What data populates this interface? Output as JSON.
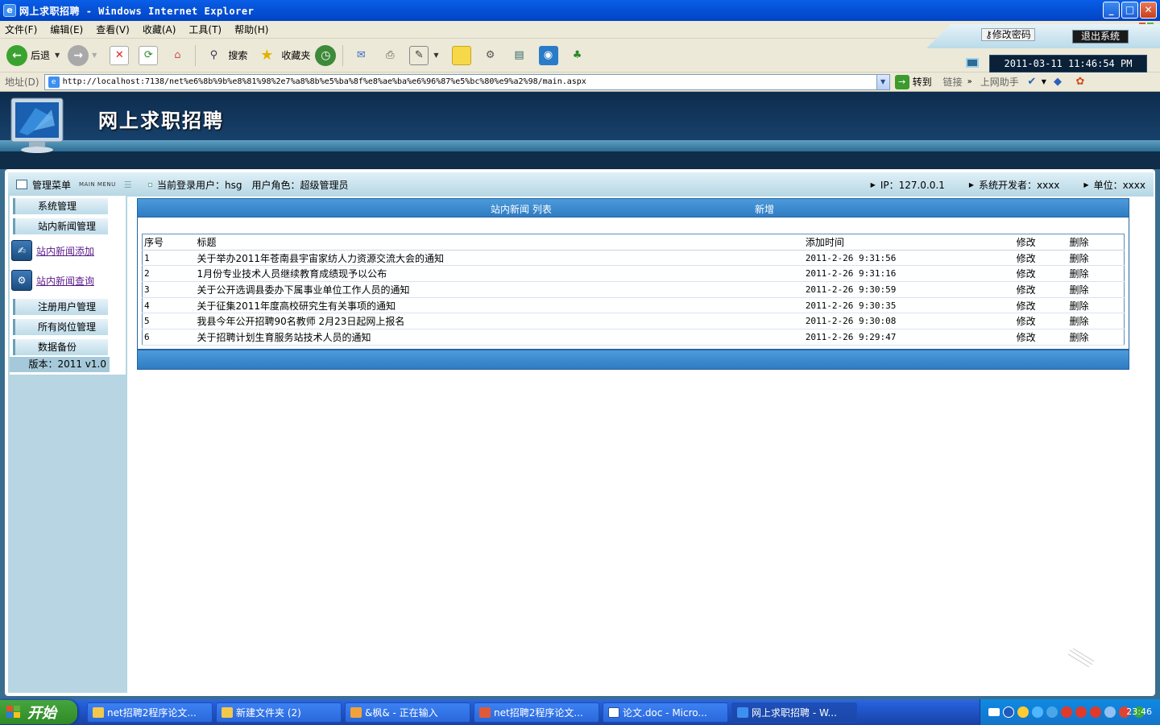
{
  "window": {
    "title": "网上求职招聘 - Windows Internet Explorer",
    "controls": [
      "_",
      "□",
      "✕"
    ]
  },
  "menubar": [
    "文件(F)",
    "编辑(E)",
    "查看(V)",
    "收藏(A)",
    "工具(T)",
    "帮助(H)"
  ],
  "toolbar": {
    "back": "后退",
    "search": "搜索",
    "favorites": "收藏夹"
  },
  "address": {
    "label": "地址(D)",
    "url": "http://localhost:7138/net%e6%8b%9b%e8%81%98%2e7%a8%8b%e5%ba%8f%e8%ae%ba%e6%96%87%e5%bc%80%e9%a2%98/main.aspx",
    "go": "转到",
    "links": "链接",
    "helper": "上网助手"
  },
  "app": {
    "title": "网上求职招聘",
    "change_password": "修改密码",
    "logout": "退出系统",
    "datetime": "2011-03-11 11:46:54 PM"
  },
  "menu": {
    "title": "管理菜单",
    "subtitle": "MAIN MENU",
    "items": [
      "系统管理",
      "站内新闻管理"
    ],
    "links": [
      "站内新闻添加",
      "站内新闻查询"
    ],
    "items2": [
      "注册用户管理",
      "所有岗位管理",
      "数据备份"
    ],
    "version": "版本：2011 v1.0"
  },
  "info": {
    "user": "当前登录用户：hsg",
    "role": "用户角色：超级管理员",
    "ip": "IP：127.0.0.1",
    "developer": "系统开发者：xxxx",
    "unit": "单位：xxxx"
  },
  "content": {
    "title": "站内新闻 列表",
    "add": "新增",
    "headers": [
      "序号",
      "标题",
      "添加时间",
      "修改",
      "删除"
    ],
    "rows": [
      [
        "1",
        "关于举办2011年苍南县宇宙家纺人力资源交流大会的通知",
        "2011-2-26 9:31:56",
        "修改",
        "删除"
      ],
      [
        "2",
        "1月份专业技术人员继续教育成绩现予以公布",
        "2011-2-26 9:31:16",
        "修改",
        "删除"
      ],
      [
        "3",
        "关于公开选调县委办下属事业单位工作人员的通知",
        "2011-2-26 9:30:59",
        "修改",
        "删除"
      ],
      [
        "4",
        "关于征集2011年度高校研究生有关事项的通知",
        "2011-2-26 9:30:35",
        "修改",
        "删除"
      ],
      [
        "5",
        "我县今年公开招聘90名教师 2月23日起网上报名",
        "2011-2-26 9:30:08",
        "修改",
        "删除"
      ],
      [
        "6",
        "关于招聘计划生育服务站技术人员的通知",
        "2011-2-26 9:29:47",
        "修改",
        "删除"
      ]
    ]
  },
  "taskbar": {
    "start": "开始",
    "tasks": [
      "net招聘2程序论文...",
      "新建文件夹 (2)",
      "&枫& - 正在输入",
      "net招聘2程序论文...",
      "论文.doc - Micro...",
      "网上求职招聘 - W..."
    ],
    "time": "23:46"
  }
}
